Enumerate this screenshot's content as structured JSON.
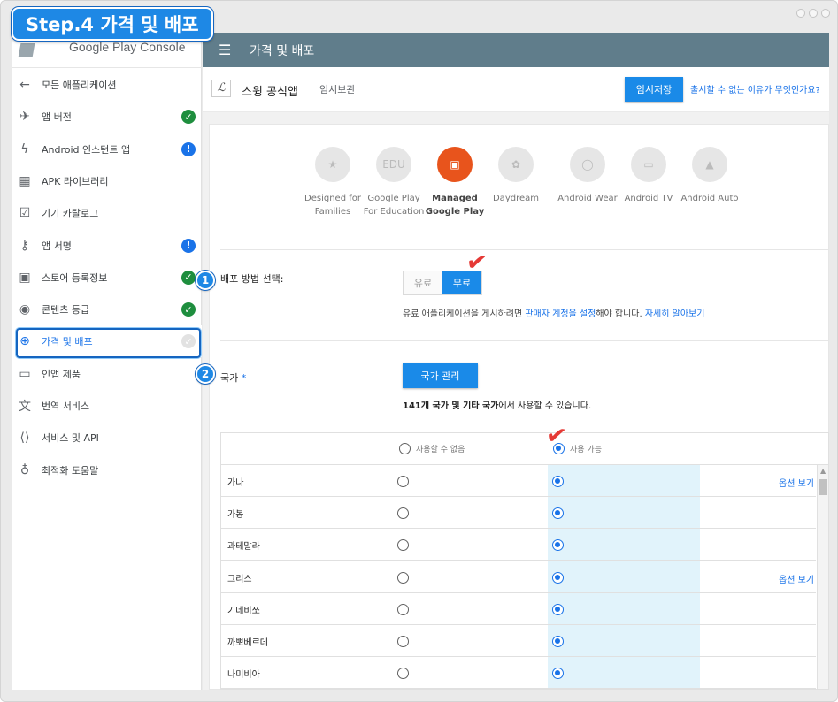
{
  "step_badge": "Step.4 가격 및 배포",
  "brand": {
    "name": "Google Play Console"
  },
  "topbar": {
    "title": "가격 및 배포"
  },
  "sidebar": {
    "items": [
      {
        "label": "모든 애플리케이션",
        "icon": "arrow-left-icon",
        "status": ""
      },
      {
        "label": "앱 버전",
        "icon": "rocket-icon",
        "status": "ok"
      },
      {
        "label": "Android 인스턴트 앱",
        "icon": "bolt-icon",
        "status": "warn"
      },
      {
        "label": "APK 라이브러리",
        "icon": "grid-icon",
        "status": ""
      },
      {
        "label": "기기 카탈로그",
        "icon": "device-catalog-icon",
        "status": ""
      },
      {
        "label": "앱 서명",
        "icon": "key-icon",
        "status": "warn"
      },
      {
        "label": "스토어 등록정보",
        "icon": "store-icon",
        "status": "ok"
      },
      {
        "label": "콘텐츠 등급",
        "icon": "rating-icon",
        "status": "ok"
      },
      {
        "label": "가격 및 배포",
        "icon": "globe-icon",
        "status": "pending"
      },
      {
        "label": "인앱 제품",
        "icon": "card-icon",
        "status": ""
      },
      {
        "label": "번역 서비스",
        "icon": "translate-icon",
        "status": ""
      },
      {
        "label": "서비스 및 API",
        "icon": "api-icon",
        "status": ""
      },
      {
        "label": "최적화 도움말",
        "icon": "lightbulb-icon",
        "status": ""
      }
    ]
  },
  "app": {
    "name": "스윙 공식앱",
    "status": "임시보관",
    "save_label": "임시저장",
    "why_link": "출시할 수 없는 이유가 무엇인가요?"
  },
  "devices": [
    {
      "line1": "Designed for",
      "line2": "Families",
      "icon": "star-face-icon",
      "glyph": "★"
    },
    {
      "line1": "Google Play",
      "line2": "For Education",
      "icon": "edu-icon",
      "glyph": "EDU"
    },
    {
      "line1": "Managed",
      "line2": "Google Play",
      "icon": "briefcase-icon",
      "glyph": "▣"
    },
    {
      "line1": "Daydream",
      "line2": "",
      "icon": "daydream-icon",
      "glyph": "✿"
    },
    {
      "line1": "Android Wear",
      "line2": "",
      "icon": "watch-icon",
      "glyph": "◯"
    },
    {
      "line1": "Android TV",
      "line2": "",
      "icon": "tv-icon",
      "glyph": "▭"
    },
    {
      "line1": "Android Auto",
      "line2": "",
      "icon": "auto-icon",
      "glyph": "▲"
    }
  ],
  "distribution": {
    "label": "배포 방법 선택:",
    "paid": "유료",
    "free": "무료",
    "selected": "free",
    "hint_prefix": "유료 애플리케이션을 게시하려면 ",
    "hint_link": "판매자 계정을 설정",
    "hint_mid": "해야 합니다. ",
    "hint_more": "자세히 알아보기"
  },
  "countries": {
    "label": "국가",
    "required_mark": "*",
    "manage_button": "국가 관리",
    "summary_bold": "141개 국가 및 기타 국가",
    "summary_rest": "에서 사용할 수 있습니다.",
    "col_unavailable": "사용할 수 없음",
    "col_available": "사용 가능",
    "options_link": "옵션 보기",
    "rows": [
      {
        "name": "가나",
        "available": true,
        "options": true
      },
      {
        "name": "가봉",
        "available": true,
        "options": false
      },
      {
        "name": "과테말라",
        "available": true,
        "options": false
      },
      {
        "name": "그리스",
        "available": true,
        "options": true
      },
      {
        "name": "기네비쏘",
        "available": true,
        "options": false
      },
      {
        "name": "까뽀베르데",
        "available": true,
        "options": false
      },
      {
        "name": "나미비아",
        "available": true,
        "options": false
      }
    ]
  },
  "markers": {
    "one": "1",
    "two": "2"
  },
  "colors": {
    "topbar": "#607d8b",
    "accent": "#1a8ae8",
    "selected_device": "#e8541c",
    "ok": "#1e8e3e",
    "warn": "#1a73e8"
  }
}
